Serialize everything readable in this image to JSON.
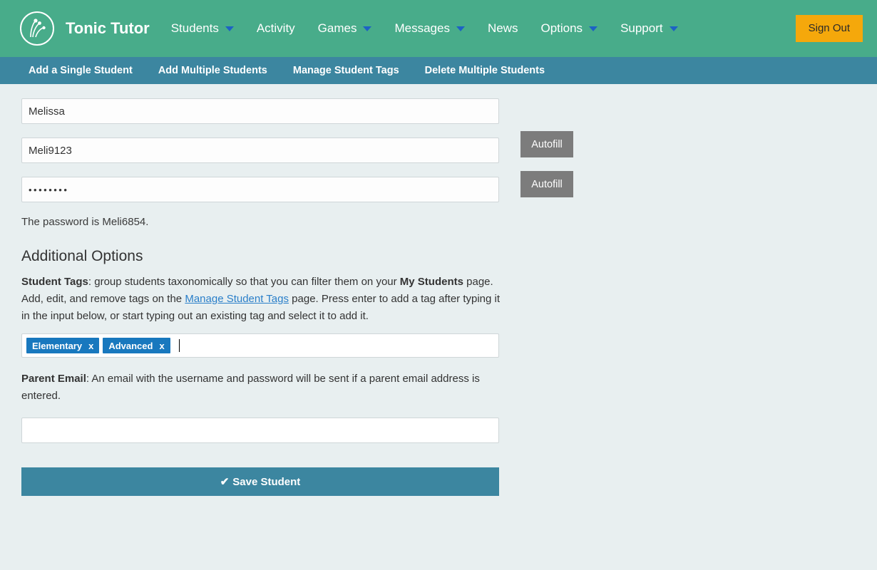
{
  "header": {
    "logo_icon": "tonic-tutor-sprout-logo",
    "brand": "Tonic Tutor",
    "nav": [
      {
        "label": "Students",
        "has_caret": true
      },
      {
        "label": "Activity",
        "has_caret": false
      },
      {
        "label": "Games",
        "has_caret": true
      },
      {
        "label": "Messages",
        "has_caret": true
      },
      {
        "label": "News",
        "has_caret": false
      },
      {
        "label": "Options",
        "has_caret": true
      },
      {
        "label": "Support",
        "has_caret": true
      }
    ],
    "sign_out": "Sign Out",
    "bg_color": "#48ac8a",
    "sign_out_color": "#f5a80b",
    "caret_color": "#1d62c4"
  },
  "subnav": {
    "bg_color": "#3c86a0",
    "items": [
      "Add a Single Student",
      "Add Multiple Students",
      "Manage Student Tags",
      "Delete Multiple Students"
    ]
  },
  "form": {
    "name_value": "Melissa",
    "name_placeholder": "",
    "username_value": "Meli9123",
    "username_placeholder": "",
    "password_value": "••••••••",
    "password_placeholder": "",
    "autofill_username_label": "Autofill",
    "autofill_password_label": "Autofill",
    "password_hint": "The password is Meli6854.",
    "section_title": "Additional Options",
    "student_tags": {
      "label": "Student Tags",
      "text_1": ": group students taxonomically so that you can filter them on your ",
      "bold_2": "My Students",
      "text_3": " page. Add, edit, and remove tags on the ",
      "link": "Manage Student Tags",
      "text_4": " page. Press enter to add a tag after typing it in the input below, or start typing out an existing tag and select it to add it.",
      "tags": [
        {
          "label": "Elementary",
          "remove": "x"
        },
        {
          "label": "Advanced",
          "remove": "x"
        }
      ],
      "tag_color": "#1878be",
      "link_color": "#2a7fc9"
    },
    "parent_email": {
      "label": "Parent Email",
      "text": ": An email with the username and password will be sent if a parent email address is entered.",
      "value": "",
      "placeholder": ""
    },
    "save_button": {
      "icon": "check-icon",
      "glyph": "✔",
      "label": "Save Student",
      "color": "#3c86a0"
    }
  },
  "page": {
    "background_color": "#e8eff0"
  }
}
